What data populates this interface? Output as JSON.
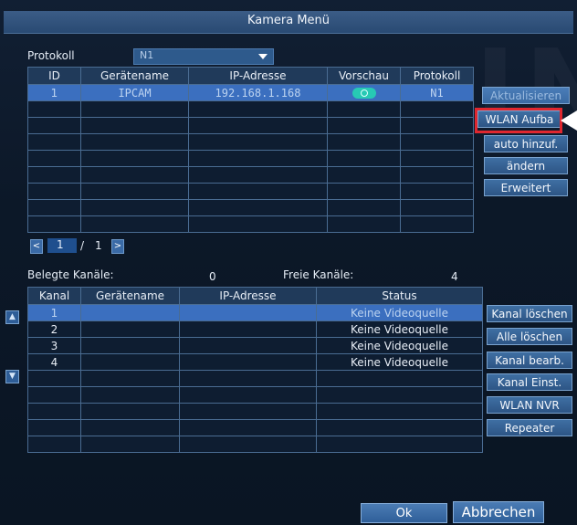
{
  "title": "Kamera Menü",
  "protocol": {
    "label": "Protokoll",
    "value": "N1"
  },
  "devices": {
    "headers": [
      "ID",
      "Gerätename",
      "IP-Adresse",
      "Vorschau",
      "Protokoll"
    ],
    "rows": [
      {
        "id": "1",
        "name": "IPCAM",
        "ip": "192.168.1.168",
        "preview": "preview-icon",
        "protocol": "N1"
      }
    ]
  },
  "pager": {
    "prev": "<",
    "current": "1",
    "sep": "/",
    "total": "1",
    "next": ">"
  },
  "actions": {
    "refresh": "Aktualisieren",
    "wlan_setup": "WLAN Aufba",
    "auto_add": "auto hinzuf.",
    "modify": "ändern",
    "advanced": "Erweitert"
  },
  "channels_info": {
    "used_label": "Belegte Kanäle:",
    "used_value": "0",
    "free_label": "Freie Kanäle:",
    "free_value": "4"
  },
  "channels": {
    "headers": [
      "Kanal",
      "Gerätename",
      "IP-Adresse",
      "Status"
    ],
    "rows": [
      {
        "channel": "1",
        "name": "",
        "ip": "",
        "status": "Keine Videoquelle"
      },
      {
        "channel": "2",
        "name": "",
        "ip": "",
        "status": "Keine Videoquelle"
      },
      {
        "channel": "3",
        "name": "",
        "ip": "",
        "status": "Keine Videoquelle"
      },
      {
        "channel": "4",
        "name": "",
        "ip": "",
        "status": "Keine Videoquelle"
      }
    ]
  },
  "channel_actions": {
    "delete_channel": "Kanal löschen",
    "delete_all": "Alle löschen",
    "edit_channel": "Kanal bearb.",
    "channel_settings": "Kanal Einst.",
    "wlan_nvr": "WLAN NVR",
    "repeater": "Repeater"
  },
  "footer": {
    "ok": "Ok",
    "cancel": "Abbrechen"
  },
  "colors": {
    "highlight": "#e0272f",
    "selected_row": "#3b6fbf",
    "preview_icon": "#27c9b4"
  }
}
